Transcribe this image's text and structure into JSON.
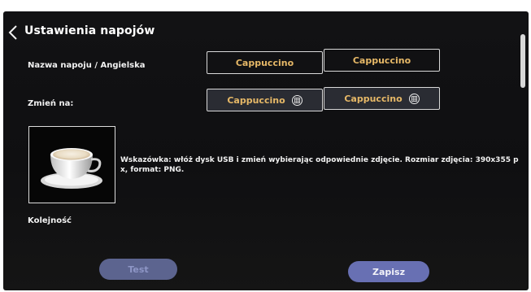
{
  "header": {
    "back_icon": "chevron-left-icon",
    "title": "Ustawienia napojów"
  },
  "form": {
    "name_label": "Nazwa napoju / Angielska",
    "name_pl": "Cappuccino",
    "name_en": "Cappuccino",
    "change_label": "Zmień na:",
    "change_pl": "Cappuccino",
    "change_en": "Cappuccino",
    "keyboard_icon": "keyboard-icon"
  },
  "image": {
    "icon": "cappuccino-cup-icon",
    "hint": "Wskazówka: włóż dysk USB i zmień wybierając odpowiednie zdjęcie. Rozmiar zdjęcia: 390x355 p x, format: PNG."
  },
  "order": {
    "label": "Kolejność"
  },
  "buttons": {
    "test_label": "Test",
    "save_label": "Zapisz"
  },
  "colors": {
    "background": "#111113",
    "value_text": "#e6b867",
    "button": "#6870b3"
  }
}
